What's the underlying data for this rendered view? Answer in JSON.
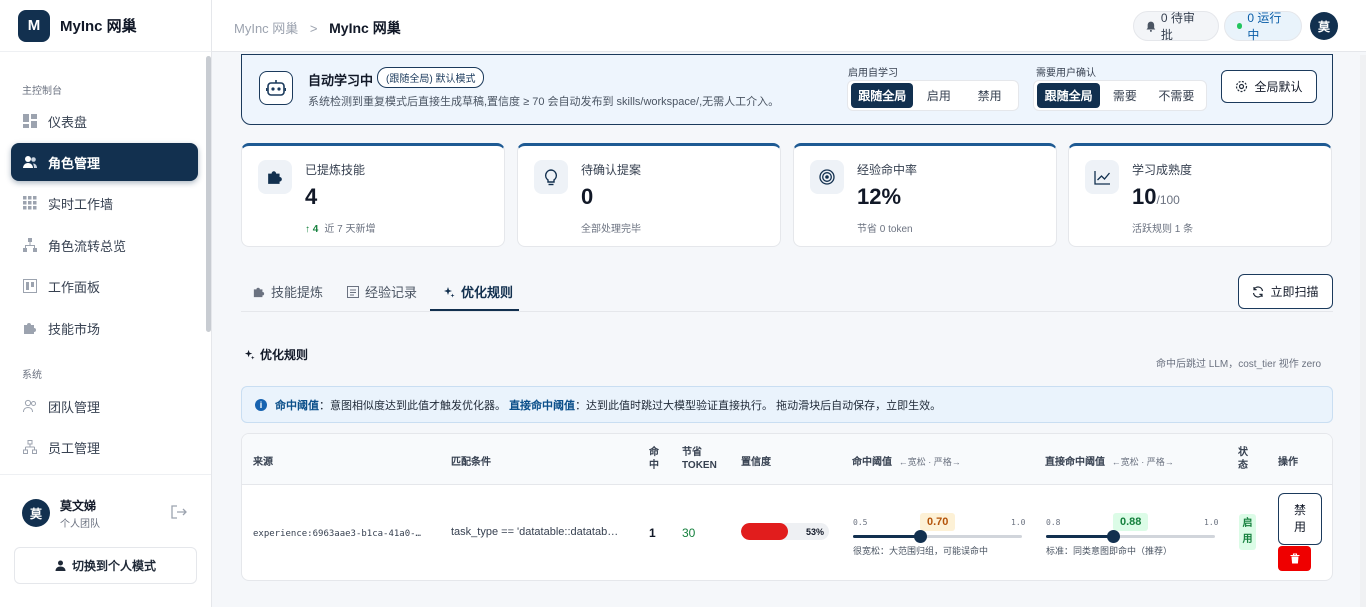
{
  "brand": {
    "logo_letter": "M",
    "name": "MyInc 网巢"
  },
  "sidebar": {
    "section_main": "主控制台",
    "section_system": "系统",
    "items": [
      {
        "label": "仪表盘",
        "icon": "dashboard-icon"
      },
      {
        "label": "角色管理",
        "icon": "users-icon",
        "active": true
      },
      {
        "label": "实时工作墙",
        "icon": "grid-icon"
      },
      {
        "label": "角色流转总览",
        "icon": "flow-icon"
      },
      {
        "label": "工作面板",
        "icon": "board-icon"
      },
      {
        "label": "技能市场",
        "icon": "puzzle-icon"
      }
    ],
    "system_items": [
      {
        "label": "团队管理",
        "icon": "team-icon"
      },
      {
        "label": "员工管理",
        "icon": "org-icon"
      }
    ],
    "user": {
      "avatar": "莫",
      "name": "莫文娣",
      "team": "个人团队"
    },
    "mode_button": "切换到个人模式"
  },
  "topbar": {
    "crumb_parent": "MyInc 网巢",
    "crumb_sep": ">",
    "crumb_current": "MyInc 网巢",
    "pending": "0 待审批",
    "running": "0 运行中",
    "avatar": "莫"
  },
  "learning": {
    "title": "自动学习中",
    "badge": "(跟随全局) 默认模式",
    "desc": "系统检测到重复模式后直接生成草稿,置信度 ≥ 70 会自动发布到 skills/workspace/,无需人工介入。",
    "enable_label": "启用自学习",
    "enable_options": [
      "跟随全局",
      "启用",
      "禁用"
    ],
    "confirm_label": "需要用户确认",
    "confirm_options": [
      "跟随全局",
      "需要",
      "不需要"
    ],
    "global_button": "全局默认"
  },
  "stats": [
    {
      "label": "已提炼技能",
      "value": "4",
      "suffix": "",
      "sub_prefix": "↑ 4",
      "sub": "近 7 天新增",
      "icon": "puzzle-icon"
    },
    {
      "label": "待确认提案",
      "value": "0",
      "suffix": "",
      "sub_prefix": "",
      "sub": "全部处理完毕",
      "icon": "bulb-icon"
    },
    {
      "label": "经验命中率",
      "value": "12%",
      "suffix": "",
      "sub_prefix": "",
      "sub": "节省 0 token",
      "icon": "target-icon"
    },
    {
      "label": "学习成熟度",
      "value": "10",
      "suffix": "/100",
      "sub_prefix": "",
      "sub": "活跃规则 1 条",
      "icon": "trend-icon"
    }
  ],
  "tabs": [
    {
      "label": "技能提炼",
      "icon": "puzzle-icon"
    },
    {
      "label": "经验记录",
      "icon": "doc-icon"
    },
    {
      "label": "优化规则",
      "icon": "sparkle-icon",
      "active": true
    }
  ],
  "scan_button": "立即扫描",
  "rules": {
    "title": "优化规则",
    "note": "命中后跳过 LLM，cost_tier 视作 zero",
    "info_b1": "命中阈值",
    "info_t1": "：意图相似度达到此值才触发优化器。",
    "info_b2": "直接命中阈值",
    "info_t2": "：达到此值时跳过大模型验证直接执行。 拖动滑块后自动保存，立即生效。",
    "headers": {
      "source": "来源",
      "match": "匹配条件",
      "hit_1": "命",
      "hit_2": "中",
      "save_1": "节省",
      "save_2": "TOKEN",
      "conf": "置信度",
      "th": "命中阈值",
      "th_hint": "←宽松 · 严格→",
      "dth": "直接命中阈值",
      "dth_hint": "←宽松 · 严格→",
      "status_1": "状",
      "status_2": "态",
      "action": "操作"
    },
    "rows": [
      {
        "source": "experience:6963aae3-b1ca-41a0-…",
        "match": "task_type == 'datatable::datatab…",
        "hits": "1",
        "saved": "30",
        "confidence": 53,
        "confidence_label": "53%",
        "threshold": {
          "min": "0.5",
          "max": "1.0",
          "value": 0.7,
          "label": "0.70",
          "hint": "很宽松：大范围归组，可能误命中"
        },
        "direct": {
          "min": "0.8",
          "max": "1.0",
          "value": 0.88,
          "label": "0.88",
          "hint": "标准：同类意图即命中（推荐）"
        },
        "status_1": "启",
        "status_2": "用",
        "disable_1": "禁",
        "disable_2": "用"
      }
    ]
  },
  "colors": {
    "primary": "#12304f",
    "accent_blue": "#1e5a93",
    "danger": "#ef0000",
    "success": "#15803d"
  }
}
